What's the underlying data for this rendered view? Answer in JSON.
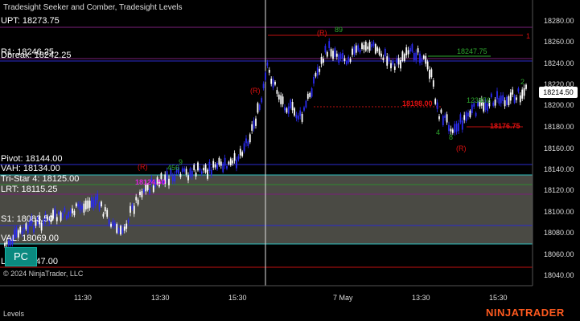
{
  "title": "Tradesight Seeker and Comber, Tradesight Levels",
  "levels": {
    "upt": "UPT: 18273.75",
    "r1": "R1: 18246.25",
    "dbreak": "Dbreak: 18242.25",
    "pivot": "Pivot: 18144.00",
    "vah": "VAH: 18134.00",
    "tristar": "Tri-Star 4: 18125.00",
    "lrt": "LRT: 18115.25",
    "s1": "S1: 18083.50",
    "val": "VAL: 18069.00",
    "lpt": "LPT: 18047.00"
  },
  "yaxis": [
    "18280.00",
    "18260.00",
    "18240.00",
    "18220.00",
    "18200.00",
    "18180.00",
    "18160.00",
    "18140.00",
    "18120.00",
    "18100.00",
    "18080.00",
    "18060.00",
    "18040.00"
  ],
  "xaxis": [
    "11:30",
    "13:30",
    "15:30",
    "7 May",
    "13:30",
    "15:30"
  ],
  "current_price": "18214.50",
  "annotations": {
    "r1": "(R)",
    "r2": "(R)",
    "r3": "(R)",
    "r4": "(R)",
    "p_upper": "18247.75",
    "p_mid": "18198.00",
    "p_low": "18176.75",
    "p_tri": "18124.50",
    "right_1": "1",
    "n_89": "89",
    "n_45": "456",
    "n_1236": "123456",
    "n_2": "2",
    "n_9": "9",
    "n_4": "4",
    "n_8": "8"
  },
  "pc_button": "PC",
  "copyright": "© 2024 NinjaTrader, LLC",
  "footer_tab": "Levels",
  "brand": "NINJATRADER",
  "colors": {
    "purple_line": "#7a1f7a",
    "blue_line": "#2b2bd0",
    "cyan_line": "#30c0c0",
    "red_line": "#c01010",
    "zone_fill": "#4a4a44",
    "up_bar": "#ffffff",
    "down_bar": "#2a2af0",
    "brand": "#ff5a1f"
  }
}
